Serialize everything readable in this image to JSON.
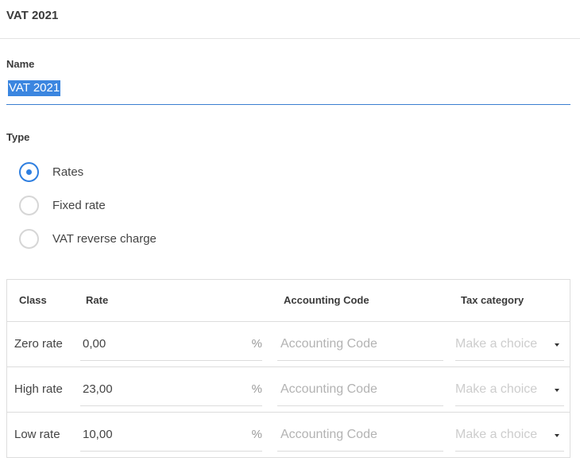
{
  "header": {
    "title": "VAT 2021"
  },
  "name": {
    "label": "Name",
    "value": "VAT 2021"
  },
  "type": {
    "label": "Type",
    "options": [
      {
        "label": "Rates",
        "checked": true
      },
      {
        "label": "Fixed rate",
        "checked": false
      },
      {
        "label": "VAT reverse charge",
        "checked": false
      }
    ]
  },
  "table": {
    "headers": {
      "class": "Class",
      "rate": "Rate",
      "accounting_code": "Accounting Code",
      "tax_category": "Tax category"
    },
    "rows": [
      {
        "class": "Zero rate",
        "rate": "0,00",
        "unit": "%",
        "accounting_placeholder": "Accounting Code",
        "tax_placeholder": "Make a choice"
      },
      {
        "class": "High rate",
        "rate": "23,00",
        "unit": "%",
        "accounting_placeholder": "Accounting Code",
        "tax_placeholder": "Make a choice"
      },
      {
        "class": "Low rate",
        "rate": "10,00",
        "unit": "%",
        "accounting_placeholder": "Accounting Code",
        "tax_placeholder": "Make a choice"
      }
    ]
  },
  "colors": {
    "accent": "#2f7fe0",
    "selection": "#3b86e0"
  }
}
